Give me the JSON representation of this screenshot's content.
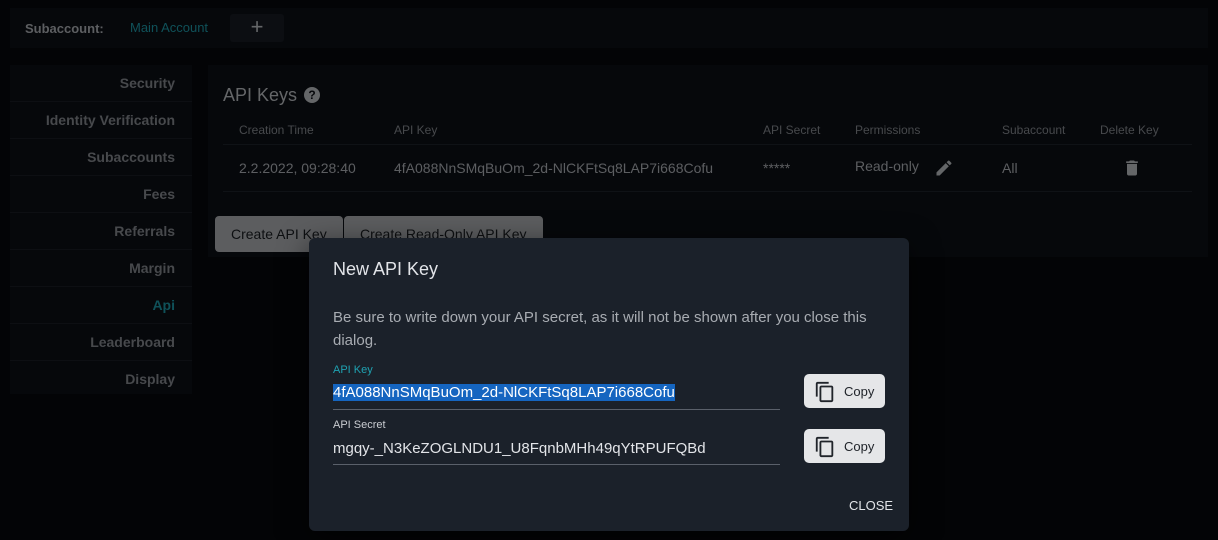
{
  "topbar": {
    "subaccount_label": "Subaccount:",
    "account_name": "Main Account",
    "add_label": "+"
  },
  "sidebar": {
    "items": [
      {
        "label": "Security"
      },
      {
        "label": "Identity Verification"
      },
      {
        "label": "Subaccounts"
      },
      {
        "label": "Fees"
      },
      {
        "label": "Referrals"
      },
      {
        "label": "Margin"
      },
      {
        "label": "Api"
      },
      {
        "label": "Leaderboard"
      },
      {
        "label": "Display"
      }
    ],
    "active": "Api"
  },
  "panel": {
    "title": "API Keys",
    "help_icon": "?",
    "columns": [
      "Creation Time",
      "API Key",
      "API Secret",
      "Permissions",
      "Subaccount",
      "Delete Key"
    ],
    "row": {
      "creation_time": "2.2.2022, 09:28:40",
      "api_key": "4fA088NnSMqBuOm_2d-NlCKFtSq8LAP7i668Cofu",
      "api_secret": "*****",
      "permissions": "Read-only",
      "subaccount": "All"
    },
    "create_button": "Create API Key",
    "create_readonly_button": "Create Read-Only API Key"
  },
  "dialog": {
    "title": "New API Key",
    "message": "Be sure to write down your API secret, as it will not be shown after you close this dialog.",
    "api_key_label": "API Key",
    "api_key_value": "4fA088NnSMqBuOm_2d-NlCKFtSq8LAP7i668Cofu",
    "api_secret_label": "API Secret",
    "api_secret_value": "mgqy-_N3KeZOGLNDU1_U8FqnbMHh49qYtRPUFQBd",
    "copy_label": "Copy",
    "close_label": "CLOSE"
  },
  "colors": {
    "accent": "#1fa2b2",
    "background": "#07090d",
    "panel": "#0d1117",
    "dialog": "#1b212a",
    "selection": "#1565c0"
  },
  "icons": {
    "add": "plus-icon",
    "help": "help-icon",
    "edit": "pencil-icon",
    "delete": "trash-icon",
    "copy": "copy-icon"
  }
}
